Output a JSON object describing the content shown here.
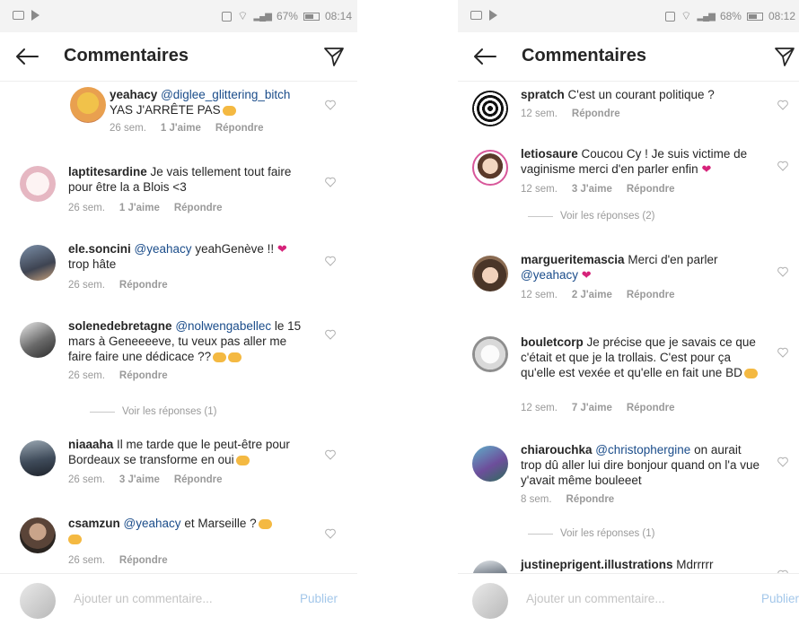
{
  "left": {
    "status": {
      "battery": "67%",
      "time": "08:14"
    },
    "header": {
      "title": "Commentaires"
    },
    "comments": [
      {
        "user": "yeahacy",
        "mention": "@diglee_glittering_bitch",
        "text": "YAS J'ARRÊTE PAS",
        "emoji": true,
        "time": "26 sem.",
        "likes": "1 J'aime",
        "reply": "Répondre"
      },
      {
        "user": "laptitesardine",
        "mention": "",
        "text": "Je vais tellement tout faire pour être la a Blois <3",
        "time": "26 sem.",
        "likes": "1 J'aime",
        "reply": "Répondre"
      },
      {
        "user": "ele.soncini",
        "mention": "@yeahacy",
        "text": "yeahGenève !!",
        "text2": "trop hâte",
        "heart": true,
        "time": "26 sem.",
        "likes": "",
        "reply": "Répondre"
      },
      {
        "user": "solenedebretagne",
        "mention": "@nolwengabellec",
        "text": "le 15 mars à Geneeeeve, tu veux pas aller me faire faire une dédicace ??",
        "emoji": true,
        "time": "26 sem.",
        "likes": "",
        "reply": "Répondre",
        "replies": "Voir les réponses (1)"
      },
      {
        "user": "niaaaha",
        "mention": "",
        "text": "Il me tarde que le peut-être pour Bordeaux se transforme en oui",
        "emoji": true,
        "time": "26 sem.",
        "likes": "3 J'aime",
        "reply": "Répondre"
      },
      {
        "user": "csamzun",
        "mention": "@yeahacy",
        "text": "et Marseille ?",
        "emoji": true,
        "time": "26 sem.",
        "likes": "",
        "reply": "Répondre"
      }
    ],
    "bar": {
      "placeholder": "Ajouter un commentaire...",
      "publish": "Publier"
    }
  },
  "right": {
    "status": {
      "battery": "68%",
      "time": "08:12"
    },
    "header": {
      "title": "Commentaires"
    },
    "comments": [
      {
        "user": "spratch",
        "mention": "",
        "text": "C'est un courant politique ?",
        "time": "12 sem.",
        "likes": "",
        "reply": "Répondre"
      },
      {
        "user": "letiosaure",
        "mention": "",
        "text": "Coucou Cy ! Je suis victime de vaginisme merci d'en parler enfin",
        "heart": true,
        "time": "12 sem.",
        "likes": "3 J'aime",
        "reply": "Répondre",
        "replies": "Voir les réponses (2)"
      },
      {
        "user": "margueritemascia",
        "mention": "",
        "text": "Merci d'en parler",
        "mention2": "@yeahacy",
        "heart": true,
        "time": "12 sem.",
        "likes": "2 J'aime",
        "reply": "Répondre"
      },
      {
        "user": "bouletcorp",
        "mention": "",
        "text": "Je précise que je savais ce que c'était et que je la trollais. C'est pour ça qu'elle est vexée et qu'elle en fait une BD",
        "emoji": true,
        "time": "12 sem.",
        "likes": "7 J'aime",
        "reply": "Répondre"
      },
      {
        "user": "chiarouchka",
        "mention": "@christophergine",
        "text": "on aurait trop dû aller lui dire bonjour quand on l'a vue y'avait même bouleeet",
        "time": "8 sem.",
        "likes": "",
        "reply": "Répondre",
        "replies": "Voir les réponses (1)"
      },
      {
        "user": "justineprigent.illustrations",
        "mention": "",
        "text": "Mdrrrrr",
        "time": "",
        "likes": "",
        "reply": ""
      }
    ],
    "bar": {
      "placeholder": "Ajouter un commentaire...",
      "publish": "Publier"
    }
  },
  "colors": {
    "mention": "#1a4c8a",
    "heart": "#d6237a",
    "publish": "#a3c7ea"
  }
}
